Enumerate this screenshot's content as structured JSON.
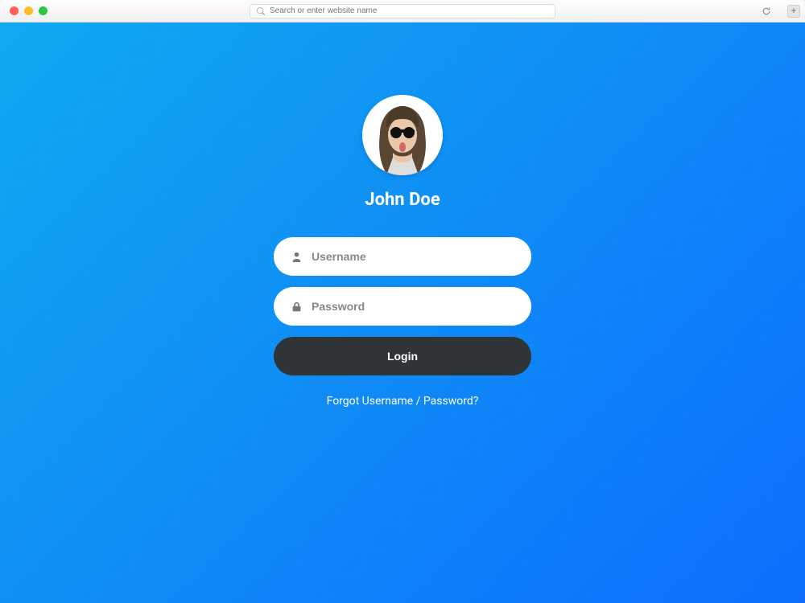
{
  "browser": {
    "address_placeholder": "Search or enter website name"
  },
  "user": {
    "name": "John Doe"
  },
  "form": {
    "username_placeholder": "Username",
    "password_placeholder": "Password",
    "login_label": "Login"
  },
  "links": {
    "forgot": "Forgot Username / Password?"
  }
}
